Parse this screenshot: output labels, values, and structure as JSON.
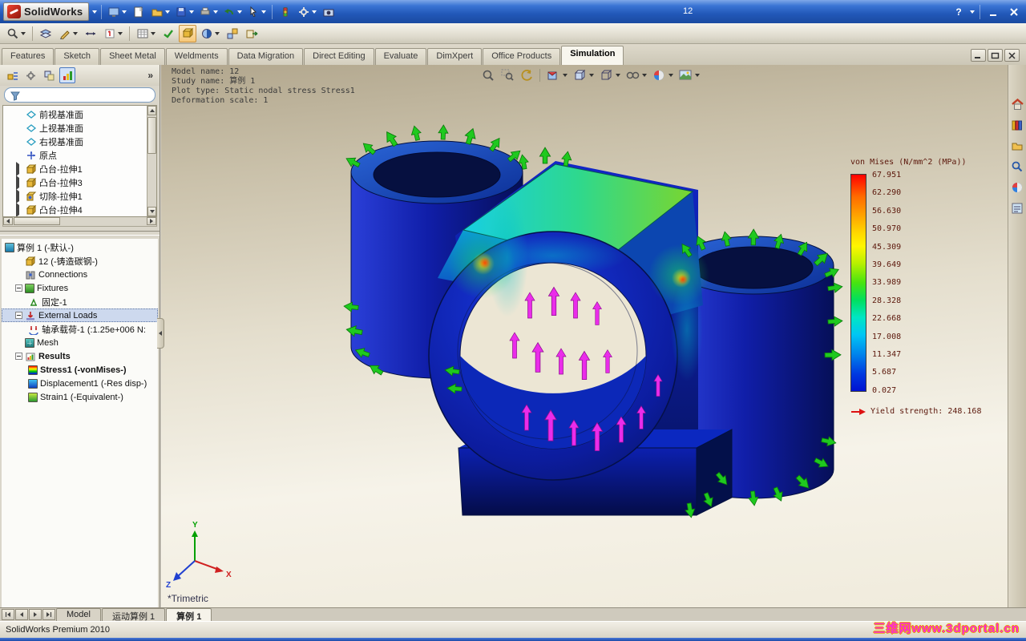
{
  "titlebar": {
    "app": "SolidWorks",
    "doc": "12"
  },
  "glyphs": {
    "help": "?",
    "more": "»"
  },
  "tabs": {
    "items": [
      "Features",
      "Sketch",
      "Sheet Metal",
      "Weldments",
      "Data Migration",
      "Direct Editing",
      "Evaluate",
      "DimXpert",
      "Office Products",
      "Simulation"
    ],
    "active": "Simulation"
  },
  "left": {
    "features": [
      "前视基准面",
      "上视基准面",
      "右视基准面",
      "原点",
      "凸台-拉伸1",
      "凸台-拉伸3",
      "切除-拉伸1",
      "凸台-拉伸4"
    ],
    "study": [
      "算例 1 (-默认-)",
      "12 (-铸造碳钢-)",
      "Connections",
      "Fixtures",
      "固定-1",
      "External Loads",
      "轴承载荷-1 (:1.25e+006 N:",
      "Mesh",
      "Results",
      "Stress1 (-vonMises-)",
      "Displacement1 (-Res disp-)",
      "Strain1 (-Equivalent-)"
    ]
  },
  "viewport": {
    "info": [
      "Model name: 12",
      "Study name: 算例 1",
      "Plot type: Static nodal stress Stress1",
      "Deformation scale: 1"
    ],
    "view_name": "*Trimetric",
    "triad": {
      "x": "X",
      "y": "Y",
      "z": "Z"
    }
  },
  "legend": {
    "title": "von Mises (N/mm^2 (MPa))",
    "values": [
      "67.951",
      "62.290",
      "56.630",
      "50.970",
      "45.309",
      "39.649",
      "33.989",
      "28.328",
      "22.668",
      "17.008",
      "11.347",
      "5.687",
      "0.027"
    ],
    "yield_label": "Yield strength: 248.168",
    "colors": {
      "max": "#ff0000",
      "min": "#0012d2"
    }
  },
  "bottom": {
    "tabs": [
      "Model",
      "运动算例 1",
      "算例 1"
    ]
  },
  "statusbar": {
    "text": "SolidWorks Premium 2010"
  },
  "watermark": "三维网www.3dportal.cn"
}
